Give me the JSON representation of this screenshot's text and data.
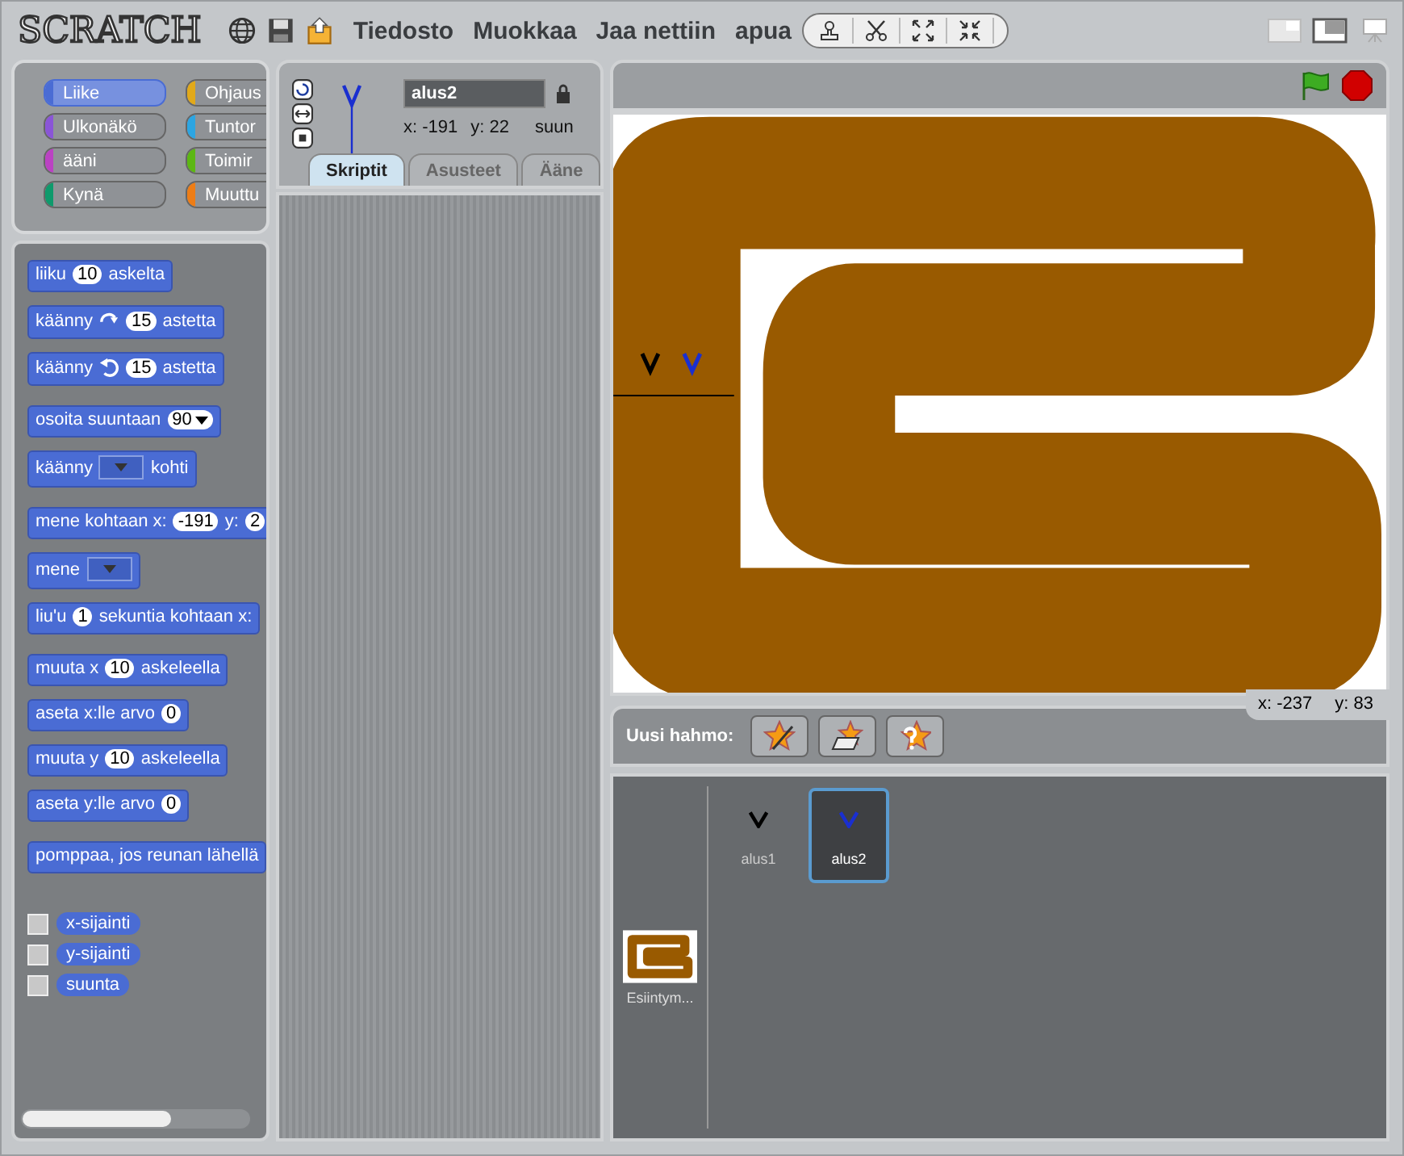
{
  "menu": {
    "logo": "SCRATCH",
    "items": [
      "Tiedosto",
      "Muokkaa",
      "Jaa nettiin",
      "apua"
    ]
  },
  "categories": [
    {
      "label": "Liike",
      "color": "#4a6cd4",
      "selected": true
    },
    {
      "label": "Ohjaus",
      "color": "#e1a91a",
      "selected": false
    },
    {
      "label": "Ulkonäkö",
      "color": "#8a55d7",
      "selected": false
    },
    {
      "label": "Tuntor",
      "color": "#2ca5e2",
      "selected": false
    },
    {
      "label": "ääni",
      "color": "#bb42c3",
      "selected": false
    },
    {
      "label": "Toimir",
      "color": "#5cb712",
      "selected": false
    },
    {
      "label": "Kynä",
      "color": "#0e9a6c",
      "selected": false
    },
    {
      "label": "Muuttu",
      "color": "#ee7d16",
      "selected": false
    }
  ],
  "block_groups": [
    [
      [
        {
          "kind": "label",
          "text": "liiku"
        },
        {
          "kind": "number",
          "text": "10"
        },
        {
          "kind": "label",
          "text": "askelta"
        }
      ],
      [
        {
          "kind": "label",
          "text": "käänny"
        },
        {
          "kind": "arrow_cw"
        },
        {
          "kind": "number",
          "text": "15"
        },
        {
          "kind": "label",
          "text": "astetta"
        }
      ],
      [
        {
          "kind": "label",
          "text": "käänny"
        },
        {
          "kind": "arrow_ccw"
        },
        {
          "kind": "number",
          "text": "15"
        },
        {
          "kind": "label",
          "text": "astetta"
        }
      ]
    ],
    [
      [
        {
          "kind": "label",
          "text": "osoita suuntaan"
        },
        {
          "kind": "menu",
          "text": "90"
        }
      ],
      [
        {
          "kind": "label",
          "text": "käänny"
        },
        {
          "kind": "menu"
        },
        {
          "kind": "label",
          "text": "kohti"
        }
      ]
    ],
    [
      [
        {
          "kind": "label",
          "text": "mene kohtaan x:"
        },
        {
          "kind": "number",
          "text": "-191"
        },
        {
          "kind": "label",
          "text": "y:"
        },
        {
          "kind": "number",
          "text": "2"
        }
      ],
      [
        {
          "kind": "label",
          "text": "mene"
        },
        {
          "kind": "menu"
        }
      ],
      [
        {
          "kind": "label",
          "text": "liu'u"
        },
        {
          "kind": "number",
          "text": "1"
        },
        {
          "kind": "label",
          "text": "sekuntia kohtaan x:"
        }
      ]
    ],
    [
      [
        {
          "kind": "label",
          "text": "muuta x"
        },
        {
          "kind": "number",
          "text": "10"
        },
        {
          "kind": "label",
          "text": "askeleella"
        }
      ],
      [
        {
          "kind": "label",
          "text": "aseta x:lle arvo"
        },
        {
          "kind": "number",
          "text": "0"
        }
      ],
      [
        {
          "kind": "label",
          "text": "muuta y"
        },
        {
          "kind": "number",
          "text": "10"
        },
        {
          "kind": "label",
          "text": "askeleella"
        }
      ],
      [
        {
          "kind": "label",
          "text": "aseta y:lle arvo"
        },
        {
          "kind": "number",
          "text": "0"
        }
      ]
    ],
    [
      [
        {
          "kind": "label",
          "text": "pomppaa, jos reunan lähellä"
        }
      ]
    ]
  ],
  "reporters": [
    {
      "label": "x-sijainti",
      "checked": false
    },
    {
      "label": "y-sijainti",
      "checked": false
    },
    {
      "label": "suunta",
      "checked": false
    }
  ],
  "sprite_info": {
    "name": "alus2",
    "x": "x:  -191",
    "y": "y:  22",
    "direction": "suun"
  },
  "tabs": [
    {
      "label": "Skriptit",
      "selected": true
    },
    {
      "label": "Asusteet",
      "selected": false
    },
    {
      "label": "Ääne",
      "selected": false
    }
  ],
  "mouse": {
    "x": "x: -237",
    "y": "y: 83"
  },
  "new_sprite_label": "Uusi hahmo:",
  "stage_thumb": {
    "label": "Esiintym..."
  },
  "sprites": [
    {
      "name": "alus1",
      "color": "#000000",
      "selected": false
    },
    {
      "name": "alus2",
      "color": "#1a2fd0",
      "selected": true
    }
  ]
}
